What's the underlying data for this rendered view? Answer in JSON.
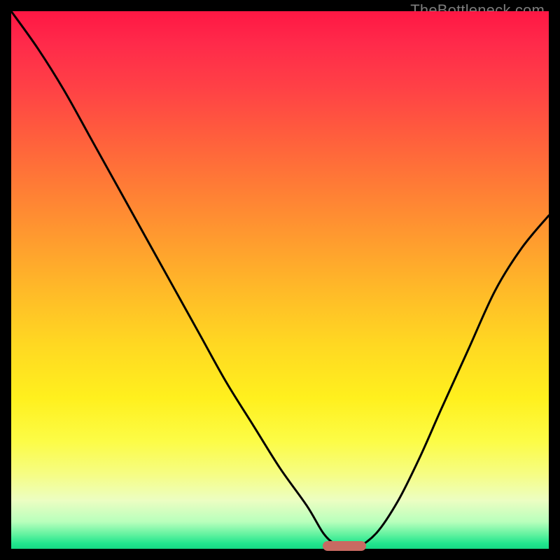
{
  "watermark": {
    "text": "TheBottleneck.com"
  },
  "chart_data": {
    "type": "line",
    "title": "",
    "xlabel": "",
    "ylabel": "",
    "xlim": [
      0,
      100
    ],
    "ylim": [
      0,
      100
    ],
    "grid": false,
    "legend": false,
    "series": [
      {
        "name": "bottleneck-curve",
        "x": [
          0,
          5,
          10,
          15,
          20,
          25,
          30,
          35,
          40,
          45,
          50,
          55,
          58,
          60,
          62,
          64,
          68,
          72,
          76,
          80,
          85,
          90,
          95,
          100
        ],
        "values": [
          100,
          93,
          85,
          76,
          67,
          58,
          49,
          40,
          31,
          23,
          15,
          8,
          3,
          1,
          0,
          0,
          3,
          9,
          17,
          26,
          37,
          48,
          56,
          62
        ]
      }
    ],
    "minimum_marker": {
      "x_start": 58,
      "x_end": 66,
      "y": 0.5
    },
    "background_gradient": {
      "direction": "vertical",
      "top": "#ff1744",
      "mid": "#ffd822",
      "bottom": "#17d884"
    }
  }
}
